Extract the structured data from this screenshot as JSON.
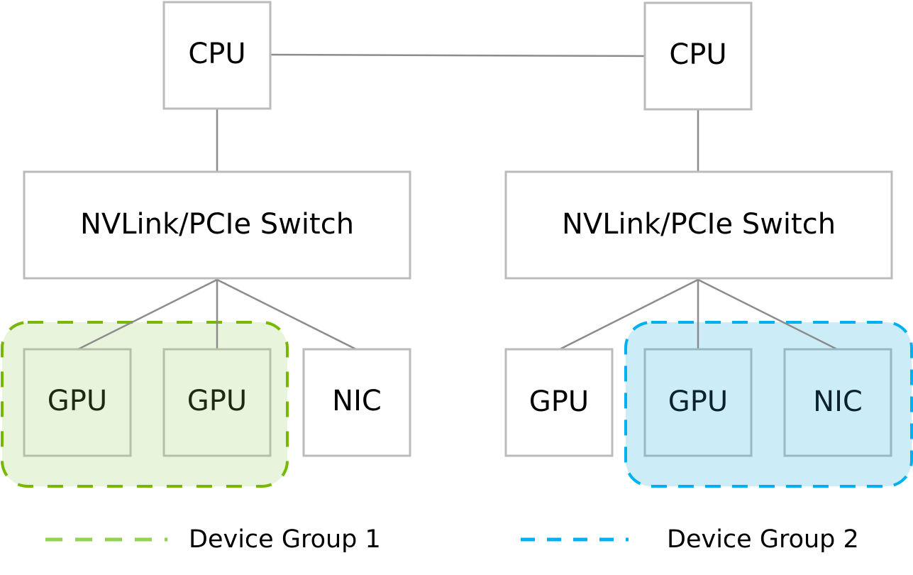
{
  "nodes": {
    "cpu_left": "CPU",
    "cpu_right": "CPU",
    "switch_left": "NVLink/PCIe Switch",
    "switch_right": "NVLink/PCIe Switch",
    "gpu_left_1": "GPU",
    "gpu_left_2": "GPU",
    "nic_left": "NIC",
    "gpu_right_1": "GPU",
    "gpu_right_2": "GPU",
    "nic_right": "NIC"
  },
  "legend": [
    {
      "label": "Device Group 1",
      "color": "#92d050"
    },
    {
      "label": "Device Group 2",
      "color": "#00b0f0"
    }
  ],
  "colors": {
    "group1_stroke": "#76b900",
    "group1_fill": "#e8f5dc",
    "group2_stroke": "#00b0f0",
    "group2_fill": "#ccedf8",
    "box_border": "#bbbbbb",
    "link": "#8c8c8c"
  }
}
